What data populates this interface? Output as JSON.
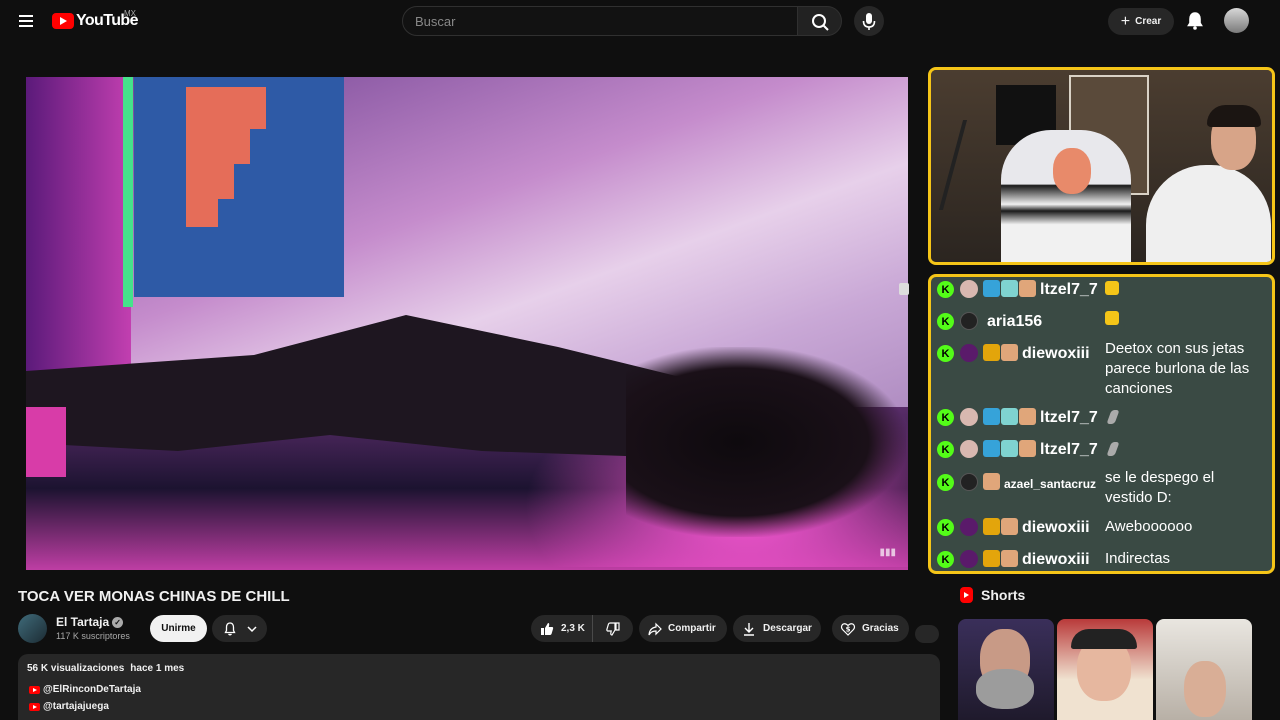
{
  "header": {
    "logo_text": "YouTube",
    "country_code": "MX",
    "search_placeholder": "Buscar",
    "create_label": "Crear"
  },
  "video": {
    "title": "TOCA VER MONAS CHINAS DE CHILL",
    "channel_name": "El Tartaja",
    "subscribers": "117 K suscriptores",
    "join_label": "Unirme",
    "likes": "2,3 K",
    "share_label": "Compartir",
    "download_label": "Descargar",
    "thanks_label": "Gracias"
  },
  "description": {
    "views": "56 K visualizaciones",
    "date": "hace 1 mes",
    "links": [
      "@ElRinconDeTartaja",
      "@tartajajuega"
    ]
  },
  "chat": {
    "messages": [
      {
        "user": "ltzel7_7",
        "text": ""
      },
      {
        "user": "aria156",
        "text": ""
      },
      {
        "user": "diewoxiii",
        "text": "Deetox con sus jetas parece burlona de las canciones"
      },
      {
        "user": "ltzel7_7",
        "text": ""
      },
      {
        "user": "ltzel7_7",
        "text": ""
      },
      {
        "user": "azael_santacruz",
        "text": "se le despego el vestido D:"
      },
      {
        "user": "diewoxiii",
        "text": "Aweboooooo"
      },
      {
        "user": "diewoxiii",
        "text": "Indirectas"
      }
    ],
    "badge_letter": "K"
  },
  "shorts": {
    "heading": "Shorts"
  },
  "colors": {
    "accent_red": "#ff0000",
    "overlay_border": "#f5c518",
    "kick_green": "#53fc18"
  }
}
